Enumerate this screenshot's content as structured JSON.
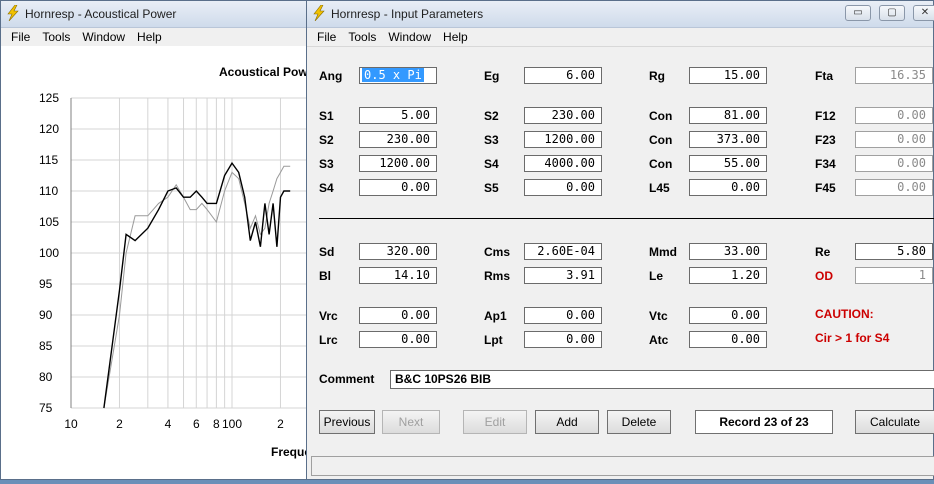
{
  "plot_window": {
    "title": "Hornresp - Acoustical Power",
    "menu": [
      "File",
      "Tools",
      "Window",
      "Help"
    ],
    "chart_title": "Acoustical Pow",
    "x_label": "Freque"
  },
  "chart_data": {
    "type": "line",
    "title": "Acoustical Pow",
    "xlabel": "Freque",
    "ylabel": "",
    "x_scale": "log",
    "ylim": [
      75,
      125
    ],
    "y_ticks": [
      "125",
      "120",
      "115",
      "110",
      "105",
      "100",
      "95",
      "90",
      "85",
      "80",
      "75"
    ],
    "x_ticks": [
      "10",
      "2",
      "4",
      "6",
      "8",
      "100",
      "2"
    ],
    "series": [
      {
        "color": "#000000",
        "x": [
          16,
          20,
          22,
          25,
          30,
          35,
          40,
          45,
          50,
          55,
          60,
          65,
          70,
          80,
          90,
          100,
          110,
          120,
          130,
          140,
          150,
          160,
          170,
          180,
          190,
          200,
          210,
          230
        ],
        "y": [
          75,
          94,
          103,
          102,
          104,
          107,
          110,
          110.5,
          109,
          109,
          110,
          109,
          108,
          108,
          112.5,
          114.5,
          113,
          109,
          102,
          105,
          101,
          108,
          103,
          108,
          101,
          109,
          110,
          110
        ]
      },
      {
        "color": "#9a9a9a",
        "x": [
          16,
          20,
          22,
          25,
          30,
          35,
          40,
          45,
          50,
          55,
          60,
          65,
          70,
          80,
          90,
          100,
          110,
          120,
          130,
          140,
          150,
          160,
          170,
          180,
          190,
          200,
          210,
          230
        ],
        "y": [
          75,
          90,
          100,
          106,
          106,
          108,
          109,
          111,
          109,
          107,
          107,
          108,
          107,
          105,
          110,
          113,
          112,
          108,
          104,
          106,
          103,
          104,
          108,
          110,
          112,
          113,
          114,
          114
        ]
      }
    ]
  },
  "input_window": {
    "title": "Hornresp - Input Parameters",
    "menu": [
      "File",
      "Tools",
      "Window",
      "Help"
    ],
    "fields": {
      "ang": {
        "label": "Ang",
        "value": "0.5 x Pi"
      },
      "eg": {
        "label": "Eg",
        "value": "6.00"
      },
      "rg": {
        "label": "Rg",
        "value": "15.00"
      },
      "fta": {
        "label": "Fta",
        "value": "16.35"
      },
      "s1a": {
        "label": "S1",
        "value": "5.00"
      },
      "s2b": {
        "label": "S2",
        "value": "230.00"
      },
      "con1": {
        "label": "Con",
        "value": "81.00"
      },
      "f12": {
        "label": "F12",
        "value": "0.00"
      },
      "s2a": {
        "label": "S2",
        "value": "230.00"
      },
      "s3b": {
        "label": "S3",
        "value": "1200.00"
      },
      "con2": {
        "label": "Con",
        "value": "373.00"
      },
      "f23": {
        "label": "F23",
        "value": "0.00"
      },
      "s3a": {
        "label": "S3",
        "value": "1200.00"
      },
      "s4b": {
        "label": "S4",
        "value": "4000.00"
      },
      "con3": {
        "label": "Con",
        "value": "55.00"
      },
      "f34": {
        "label": "F34",
        "value": "0.00"
      },
      "s4a": {
        "label": "S4",
        "value": "0.00"
      },
      "s5": {
        "label": "S5",
        "value": "0.00"
      },
      "l45": {
        "label": "L45",
        "value": "0.00"
      },
      "f45": {
        "label": "F45",
        "value": "0.00"
      },
      "sd": {
        "label": "Sd",
        "value": "320.00"
      },
      "cms": {
        "label": "Cms",
        "value": "2.60E-04"
      },
      "mmd": {
        "label": "Mmd",
        "value": "33.00"
      },
      "re": {
        "label": "Re",
        "value": "5.80"
      },
      "bl": {
        "label": "Bl",
        "value": "14.10"
      },
      "rms": {
        "label": "Rms",
        "value": "3.91"
      },
      "le": {
        "label": "Le",
        "value": "1.20"
      },
      "od": {
        "label": "OD",
        "value": "1"
      },
      "vrc": {
        "label": "Vrc",
        "value": "0.00"
      },
      "ap1": {
        "label": "Ap1",
        "value": "0.00"
      },
      "vtc": {
        "label": "Vtc",
        "value": "0.00"
      },
      "lrc": {
        "label": "Lrc",
        "value": "0.00"
      },
      "lpt": {
        "label": "Lpt",
        "value": "0.00"
      },
      "atc": {
        "label": "Atc",
        "value": "0.00"
      }
    },
    "caution": "CAUTION:",
    "caution_msg": "Cir > 1 for S4",
    "comment_label": "Comment",
    "comment_value": "B&C 10PS26 BIB",
    "buttons": {
      "previous": "Previous",
      "next": "Next",
      "edit": "Edit",
      "add": "Add",
      "delete": "Delete",
      "record": "Record 23 of 23",
      "calculate": "Calculate"
    },
    "win_buttons": {
      "minimize": "▭",
      "restore": "▢",
      "close": "✕"
    }
  }
}
